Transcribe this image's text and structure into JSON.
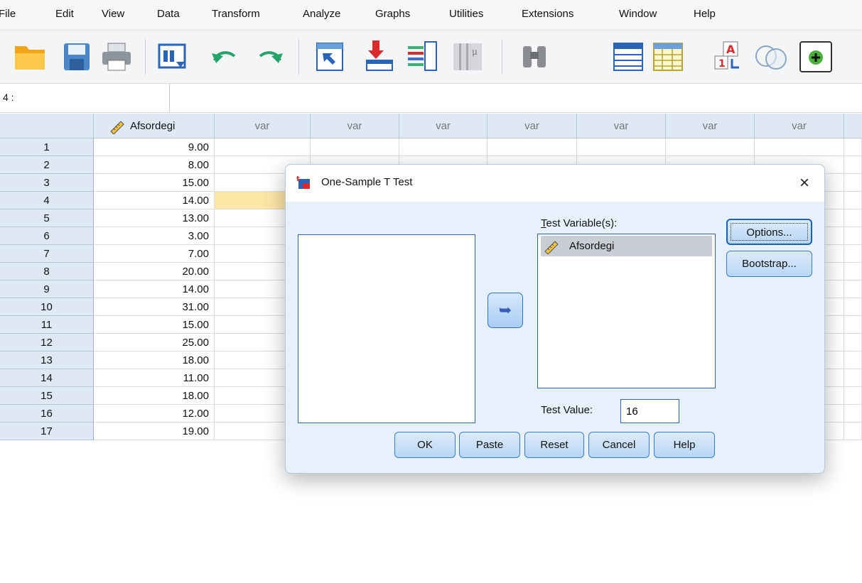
{
  "menu": [
    "File",
    "Edit",
    "View",
    "Data",
    "Transform",
    "Analyze",
    "Graphs",
    "Utilities",
    "Extensions",
    "Window",
    "Help"
  ],
  "toolbar": {
    "icons": [
      "open-folder-icon",
      "save-icon",
      "print-icon",
      "dialog-recall-icon",
      "undo-icon",
      "redo-icon",
      "goto-case-icon",
      "insert-cases-icon",
      "insert-variable-icon",
      "split-file-icon",
      "find-icon",
      "value-labels-icon",
      "use-sets-icon",
      "sort-icon",
      "visible-sets-icon",
      "add-icon"
    ]
  },
  "cell_editor": {
    "ref": "4 :"
  },
  "grid": {
    "columns": [
      "Afsordegi",
      "var",
      "var",
      "var",
      "var",
      "var",
      "var",
      "var"
    ],
    "rows": [
      {
        "n": "1",
        "v": "9.00"
      },
      {
        "n": "2",
        "v": "8.00"
      },
      {
        "n": "3",
        "v": "15.00"
      },
      {
        "n": "4",
        "v": "14.00"
      },
      {
        "n": "5",
        "v": "13.00"
      },
      {
        "n": "6",
        "v": "3.00"
      },
      {
        "n": "7",
        "v": "7.00"
      },
      {
        "n": "8",
        "v": "20.00"
      },
      {
        "n": "9",
        "v": "14.00"
      },
      {
        "n": "10",
        "v": "31.00"
      },
      {
        "n": "11",
        "v": "15.00"
      },
      {
        "n": "12",
        "v": "25.00"
      },
      {
        "n": "13",
        "v": "18.00"
      },
      {
        "n": "14",
        "v": "11.00"
      },
      {
        "n": "15",
        "v": "18.00"
      },
      {
        "n": "16",
        "v": "12.00"
      },
      {
        "n": "17",
        "v": "19.00"
      }
    ],
    "selected_row": "4"
  },
  "dialog": {
    "title": "One-Sample T Test",
    "close": "×",
    "test_variables_label": "Test Variable(s):",
    "test_variables": [
      "Afsordegi"
    ],
    "move_arrow": "➥",
    "options_label": "Options...",
    "bootstrap_label": "Bootstrap...",
    "test_value_label": "Test Value:",
    "test_value": "16",
    "buttons": {
      "ok": "OK",
      "paste": "Paste",
      "reset": "Reset",
      "cancel": "Cancel",
      "help": "Help"
    }
  }
}
